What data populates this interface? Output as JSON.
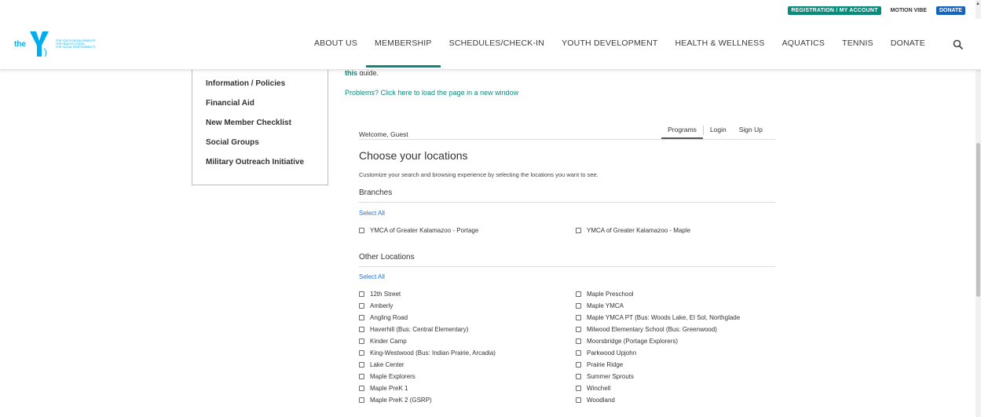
{
  "utility": {
    "registration": "REGISTRATION / MY ACCOUNT",
    "motion_vibe": "MOTION VIBE",
    "donate": "DONATE"
  },
  "logo": {
    "the": "the",
    "tag1": "FOR YOUTH DEVELOPMENT®",
    "tag2": "FOR HEALTHY LIVING",
    "tag3": "FOR SOCIAL RESPONSIBILITY"
  },
  "nav": {
    "items": [
      "ABOUT US",
      "MEMBERSHIP",
      "SCHEDULES/CHECK-IN",
      "YOUTH DEVELOPMENT",
      "HEALTH & WELLNESS",
      "AQUATICS",
      "TENNIS",
      "DONATE"
    ]
  },
  "sidebar": {
    "items": [
      "Information / Policies",
      "Financial Aid",
      "New Member Checklist",
      "Social Groups",
      "Military Outreach Initiative"
    ]
  },
  "content": {
    "guide_link": "this",
    "guide_rest": " guide.",
    "problems": "Problems? Click here to load the page in a new window"
  },
  "widget": {
    "welcome": "Welcome, Guest",
    "tabs": [
      "Programs",
      "Login",
      "Sign Up"
    ],
    "title": "Choose your locations",
    "description": "Customize your search and browsing experience by selecting the locations you want to see.",
    "branches_heading": "Branches",
    "other_heading": "Other Locations",
    "select_all": "Select All",
    "branches": [
      "YMCA of Greater Kalamazoo - Portage",
      "YMCA of Greater Kalamazoo - Maple"
    ],
    "other_left": [
      "12th Street",
      "Amberly",
      "Angling Road",
      "Haverhill (Bus: Central Elementary)",
      "Kinder Camp",
      "King-Westwood (Bus: Indian Prairie, Arcadia)",
      "Lake Center",
      "Maple Explorers",
      "Maple PreK 1",
      "Maple PreK 2 (GSRP)"
    ],
    "other_right": [
      "Maple Preschool",
      "Maple YMCA",
      "Maple YMCA PT (Bus: Woods Lake, El Sol, Northglade",
      "Milwood Elementary School (Bus: Greenwood)",
      "Moorsbridge (Portage Explorers)",
      "Parkwood Upjohn",
      "Prairie Ridge",
      "Summer Sprouts",
      "Winchell",
      "Woodland"
    ]
  },
  "colors": {
    "teal": "#0a8a7a",
    "link_blue": "#1a73e8",
    "ymca_blue": "#00aeef"
  }
}
